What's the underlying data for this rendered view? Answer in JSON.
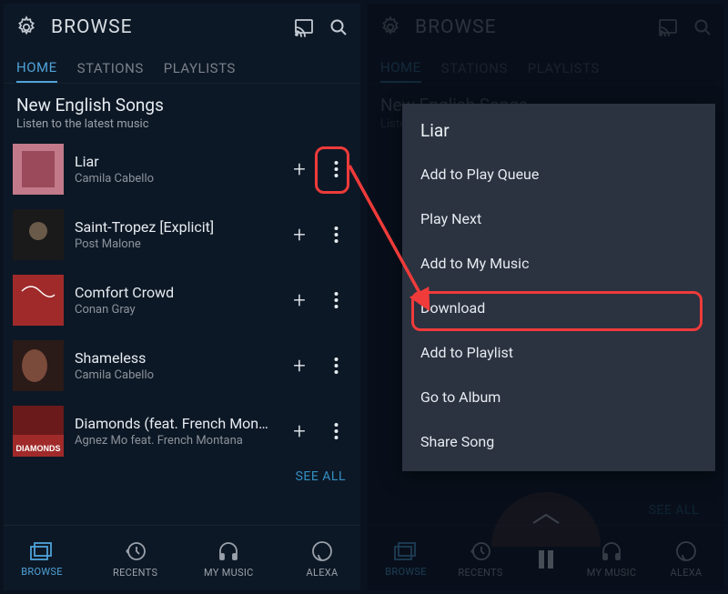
{
  "topbar": {
    "title": "BROWSE"
  },
  "tabs": [
    {
      "label": "HOME",
      "active": true
    },
    {
      "label": "STATIONS",
      "active": false
    },
    {
      "label": "PLAYLISTS",
      "active": false
    }
  ],
  "section": {
    "title": "New English Songs",
    "subtitle": "Listen to the latest music"
  },
  "songs": [
    {
      "title": "Liar",
      "artist": "Camila Cabello",
      "cover_hint": "pink"
    },
    {
      "title": "Saint-Tropez [Explicit]",
      "artist": "Post Malone",
      "cover_hint": "dark"
    },
    {
      "title": "Comfort Crowd",
      "artist": "Conan Gray",
      "cover_hint": "red-script"
    },
    {
      "title": "Shameless",
      "artist": "Camila Cabello",
      "cover_hint": "portrait"
    },
    {
      "title": "Diamonds (feat. French Monta…",
      "artist": "Agnez Mo feat. French Montana",
      "cover_hint": "diamonds"
    }
  ],
  "see_all_label": "SEE ALL",
  "bottom_nav": [
    {
      "label": "BROWSE",
      "active": true,
      "icon": "browse"
    },
    {
      "label": "RECENTS",
      "active": false,
      "icon": "recents"
    },
    {
      "label": "MY MUSIC",
      "active": false,
      "icon": "mymusic"
    },
    {
      "label": "ALEXA",
      "active": false,
      "icon": "alexa"
    }
  ],
  "context_menu": {
    "title": "Liar",
    "items": [
      "Add to Play Queue",
      "Play Next",
      "Add to My Music",
      "Download",
      "Add to Playlist",
      "Go to Album",
      "Share Song"
    ],
    "highlighted_index": 3
  },
  "icons": {
    "plus": "+"
  }
}
